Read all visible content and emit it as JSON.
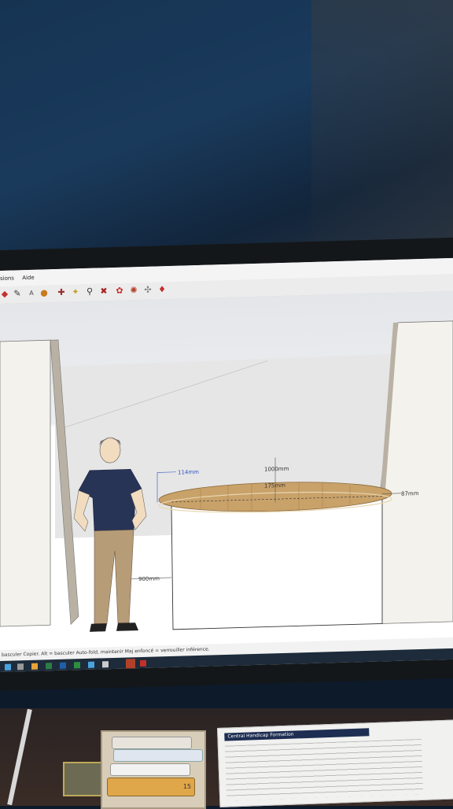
{
  "menu": {
    "items": [
      "sions",
      "Aide"
    ]
  },
  "toolbar": {
    "icons": [
      "orbit-icon",
      "look-around-icon",
      "text-icon",
      "paint-icon",
      "walk-icon",
      "position-camera-icon",
      "zoom-icon",
      "zoom-extents-icon",
      "component-icon",
      "3d-warehouse-icon",
      "extension-icon",
      "ruby-icon"
    ]
  },
  "dimensions": {
    "top_left": "114mm",
    "width": "1000mm",
    "center": "175mm",
    "right": "87mm",
    "height": "900mm"
  },
  "status": {
    "hint": "basculer Copier. Alt = basculer Auto-fold, maintenir Maj enfoncé = verrouiller inférence."
  },
  "desk": {
    "paper_header": "Central Handicap Formation",
    "tube_label": "15"
  },
  "colors": {
    "tabletop": "#c9a26a",
    "shirt": "#283456",
    "trousers": "#b79c78",
    "wall": "#f4f2ec",
    "dimension_blue": "#2c4fbf"
  }
}
